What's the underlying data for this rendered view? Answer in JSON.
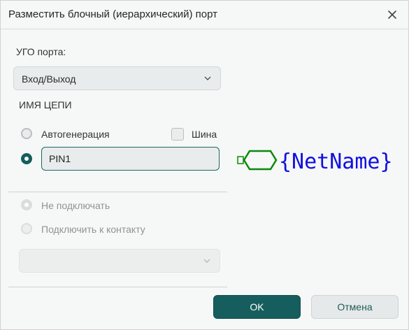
{
  "dialog": {
    "title": "Разместить блочный (иерархический) порт",
    "close_icon": "close-icon"
  },
  "port_symbol": {
    "label": "УГО порта:",
    "selected": "Вход/Выход"
  },
  "net_name": {
    "section_label": "ИМЯ ЦЕПИ",
    "autogen_label": "Автогенерация",
    "autogen_checked": false,
    "bus_label": "Шина",
    "bus_checked": false,
    "manual_checked": true,
    "value": "PIN1"
  },
  "connection": {
    "no_connect_label": "Не подключать",
    "connect_to_pin_label": "Подключить к контакту",
    "pin_select_value": ""
  },
  "preview": {
    "text": "{NetName}",
    "symbol_color": "#0a8a0a",
    "text_color": "#1010e0"
  },
  "buttons": {
    "ok_label": "OK",
    "cancel_label": "Отмена"
  }
}
